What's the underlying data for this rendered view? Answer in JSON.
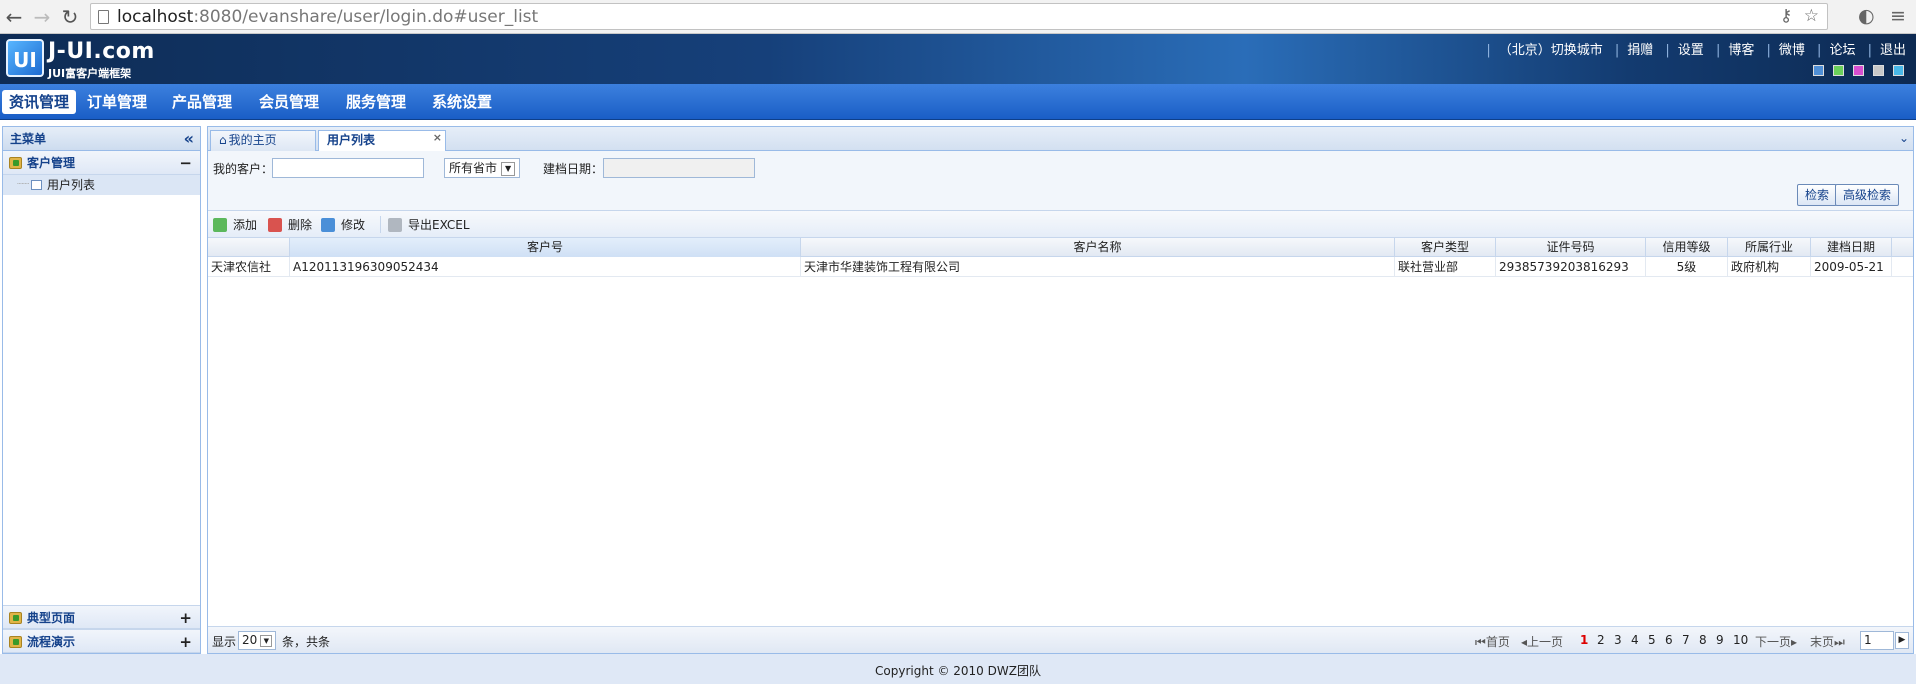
{
  "browser": {
    "url_host": "localhost",
    "url_rest": ":8080/evanshare/user/login.do#user_list"
  },
  "header": {
    "logo_mark": "UI",
    "logo_title": "J-UI.com",
    "logo_sub": "JUI富客户端框架",
    "links": [
      "（北京）切换城市",
      "捐赠",
      "设置",
      "博客",
      "微博",
      "论坛",
      "退出"
    ],
    "theme_colors": [
      "#4f8fd6",
      "#6bd05b",
      "#d84fd0",
      "#c8c8c8",
      "#49b8e8"
    ]
  },
  "main_nav": {
    "items": [
      "资讯管理",
      "订单管理",
      "产品管理",
      "会员管理",
      "服务管理",
      "系统设置"
    ]
  },
  "sidebar": {
    "title": "主菜单",
    "collapse_glyph": "«",
    "group1": "客户管理",
    "group1_toggle": "−",
    "group1_items": [
      "用户列表"
    ],
    "group2": "典型页面",
    "group3": "流程演示",
    "expand_glyph": "+"
  },
  "tabs": {
    "home": "我的主页",
    "active": "用户列表",
    "close_glyph": "×"
  },
  "search": {
    "customer_label": "我的客户：",
    "customer_value": "",
    "province_select": "所有省市",
    "date_label": "建档日期：",
    "search_btn": "检索",
    "advanced_btn": "高级检索"
  },
  "toolbar": {
    "add": "添加",
    "delete": "删除",
    "edit": "修改",
    "export": "导出EXCEL"
  },
  "grid": {
    "columns": [
      "",
      "客户号",
      "客户名称",
      "客户类型",
      "证件号码",
      "信用等级",
      "所属行业",
      "建档日期"
    ],
    "rows": [
      [
        "天津农信社",
        "A120113196309052434",
        "天津市华建装饰工程有限公司",
        "联社营业部",
        "29385739203816293",
        "5级",
        "政府机构",
        "2009-05-21"
      ]
    ]
  },
  "pager": {
    "show_label": "显示",
    "page_size": "20",
    "total_label": "条，共条",
    "first": "首页",
    "prev": "上一页",
    "pages": [
      "1",
      "2",
      "3",
      "4",
      "5",
      "6",
      "7",
      "8",
      "9",
      "10"
    ],
    "current_page": "1",
    "next": "下一页",
    "last": "末页",
    "jump_value": "1"
  },
  "footer": {
    "text": "Copyright © 2010 DWZ团队"
  }
}
